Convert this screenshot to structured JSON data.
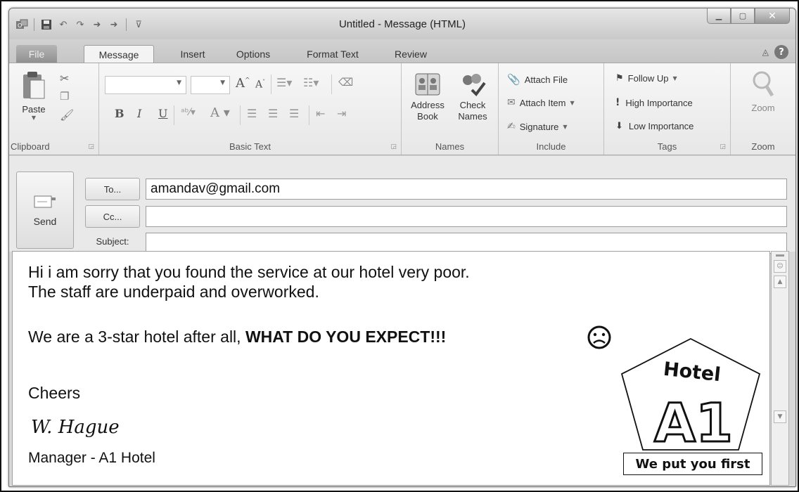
{
  "window": {
    "title": "Untitled  -  Message (HTML)",
    "controls": [
      "minimize",
      "maximize",
      "close"
    ]
  },
  "quick_access": {
    "icons": [
      "outlook-icon",
      "save-icon",
      "undo-icon",
      "redo-icon",
      "up-arrow-icon",
      "down-arrow-icon",
      "customize-icon"
    ]
  },
  "tabs": [
    {
      "label": "File"
    },
    {
      "label": "Message"
    },
    {
      "label": "Insert"
    },
    {
      "label": "Options"
    },
    {
      "label": "Format Text"
    },
    {
      "label": "Review"
    }
  ],
  "ribbon": {
    "clipboard": {
      "label": "Clipboard",
      "paste": "Paste"
    },
    "basic_text": {
      "label": "Basic Text",
      "bold": "B",
      "italic": "I",
      "underline": "U"
    },
    "names": {
      "label": "Names",
      "address_book": [
        "Address",
        "Book"
      ],
      "check_names": [
        "Check",
        "Names"
      ]
    },
    "include": {
      "label": "Include",
      "attach_file": "Attach File",
      "attach_item": "Attach Item",
      "signature": "Signature"
    },
    "tags": {
      "label": "Tags",
      "follow_up": "Follow Up",
      "high_importance": "High Importance",
      "low_importance": "Low Importance"
    },
    "zoom": {
      "label": "Zoom",
      "button": "Zoom"
    }
  },
  "compose": {
    "send": "Send",
    "to_button": "To...",
    "cc_button": "Cc...",
    "subject_label": "Subject:",
    "to_value": "amandav@gmail.com",
    "cc_value": "",
    "subject_value": ""
  },
  "message": {
    "line1": "Hi i am sorry that you found the service at our hotel very poor.",
    "line2": "The staff are underpaid and overworked.",
    "line3_prefix": "We are a 3-star hotel after all, ",
    "line3_bold": "WHAT DO YOU EXPECT!!!",
    "closing": "Cheers",
    "signature": "W. Hague",
    "signoff": "Manager - A1 Hotel"
  },
  "logo": {
    "word": "Hotel",
    "mark": "A1",
    "tagline": "We put you first"
  }
}
